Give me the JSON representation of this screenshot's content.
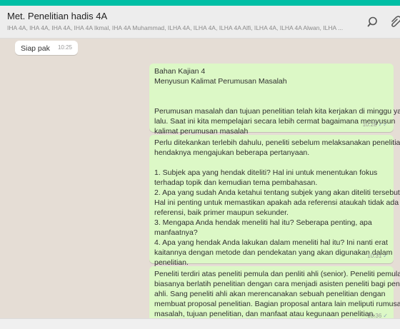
{
  "header": {
    "title": "Met. Penelitian hadis 4A",
    "members": "IHA 4A, IHA 4A, IHA 4A, IHA 4A Ikmal, IHA 4A Muhammad, ILHA 4A, ILHA 4A, ILHA 4A Alfi, ILHA 4A, ILHA 4A Alwan, ILHA ...",
    "search_icon": "search-icon",
    "attach_icon": "paperclip-icon"
  },
  "messages": [
    {
      "id": "m1",
      "direction": "in",
      "lines": [
        "Siap pak"
      ],
      "time": "10:25"
    },
    {
      "id": "m2",
      "direction": "out",
      "lines": [
        "Bahan Kajian 4",
        "Menyusun Kalimat Perumusan Masalah",
        "",
        "",
        "Perumusan masalah dan tujuan penelitian telah kita kerjakan di minggu yang",
        "lalu. Saat ini kita mempelajari secara lebih cermat bagaimana menyusun",
        "kalimat perumusan masalah"
      ],
      "time": "10:28",
      "ticks": "✓✓"
    },
    {
      "id": "m3",
      "direction": "out",
      "lines": [
        "Perlu ditekankan terlebih dahulu, peneliti sebelum melaksanakan penelitian",
        "hendaknya mengajukan beberapa pertanyaan.",
        "",
        "1.    Subjek apa yang hendak diteliti? Hal ini untuk menentukan fokus",
        "terhadap topik dan kemudian tema pembahasan.",
        "2.    Apa yang sudah Anda ketahui tentang subjek yang akan diteliti tersebut?",
        "Hal ini penting untuk memastikan apakah ada referensi ataukah tidak ada",
        "referensi, baik primer maupun sekunder.",
        "3.    Mengapa Anda hendak meneliti hal itu? Seberapa penting, apa",
        "manfaatnya?",
        "4.    Apa yang hendak Anda lakukan dalam meneliti hal itu? Ini nanti erat",
        "kaitannya dengan metode dan pendekatan yang akan digunakan dalam",
        "penelitian."
      ],
      "time": "10:31",
      "ticks": "✓"
    },
    {
      "id": "m4",
      "direction": "out",
      "lines": [
        "Peneliti terdiri atas peneliti pemula dan penliti ahli (senior). Peneliti pemula",
        "biasanya berlatih penelitian dengan cara menjadi asisten peneliti bagi peneliti",
        "ahli. Sang peneliti ahli akan merencanakan sebuah penelitian dengan",
        "membuat proposal penelitian. Bagian proposal antara lain meliputi rumusan",
        "masalah, tujuan penelitian, dan manfaat atau kegunaan penelitian."
      ],
      "time": "10:36",
      "ticks": "✓"
    }
  ]
}
